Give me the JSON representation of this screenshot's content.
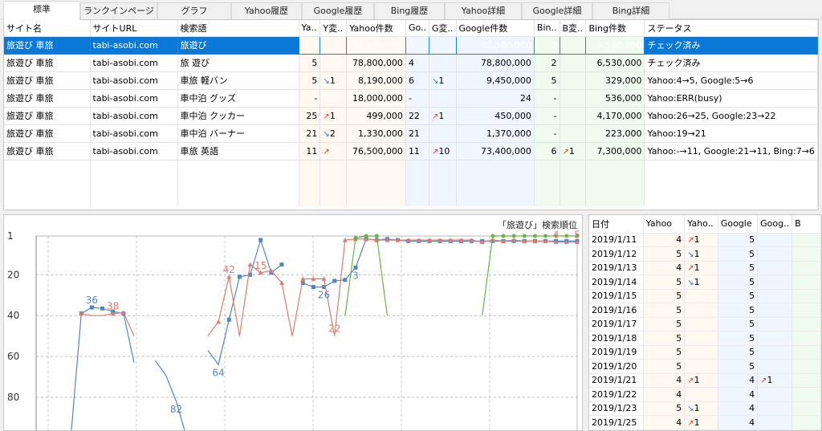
{
  "tabs": [
    "標準",
    "ランクインページ",
    "グラフ",
    "Yahoo履歴",
    "Google履歴",
    "Bing履歴",
    "Yahoo詳細",
    "Google詳細",
    "Bing詳細"
  ],
  "columns": [
    "サイト名",
    "サイトURL",
    "検索語",
    "Ya..",
    "Y変..",
    "Yahoo件数",
    "Go..",
    "G変..",
    "Google件数",
    "Bin..",
    "B変..",
    "Bing件数",
    "ステータス"
  ],
  "rows": [
    {
      "site": "旅遊び 車旅",
      "url": "tabi-asobi.com",
      "kw": "旅遊び",
      "y": "5",
      "yc": "",
      "yd": "",
      "yn": "82,300,000",
      "g": "5",
      "gc": "",
      "gd": "",
      "gn": "82,300,000",
      "b": "2",
      "bc": "",
      "bd": "",
      "bn": "6,530,000",
      "status": "チェック済み"
    },
    {
      "site": "旅遊び 車旅",
      "url": "tabi-asobi.com",
      "kw": "旅 遊び",
      "y": "5",
      "yc": "",
      "yd": "",
      "yn": "78,800,000",
      "g": "4",
      "gc": "",
      "gd": "",
      "gn": "78,800,000",
      "b": "2",
      "bc": "",
      "bd": "",
      "bn": "6,530,000",
      "status": "チェック済み"
    },
    {
      "site": "旅遊び 車旅",
      "url": "tabi-asobi.com",
      "kw": "車旅 軽バン",
      "y": "5",
      "yc": "1",
      "yd": "down",
      "yn": "8,190,000",
      "g": "6",
      "gc": "1",
      "gd": "down",
      "gn": "9,450,000",
      "b": "5",
      "bc": "",
      "bd": "",
      "bn": "329,000",
      "status": "Yahoo:4→5, Google:5→6"
    },
    {
      "site": "旅遊び 車旅",
      "url": "tabi-asobi.com",
      "kw": "車中泊 グッズ",
      "y": "-",
      "yc": "",
      "yd": "",
      "yn": "18,000,000",
      "g": "-",
      "gc": "",
      "gd": "",
      "gn": "24",
      "b": "-",
      "bc": "",
      "bd": "",
      "bn": "536,000",
      "status": "Yahoo:ERR(busy)"
    },
    {
      "site": "旅遊び 車旅",
      "url": "tabi-asobi.com",
      "kw": "車中泊 クッカー",
      "y": "25",
      "yc": "1",
      "yd": "up",
      "yn": "499,000",
      "g": "22",
      "gc": "1",
      "gd": "up",
      "gn": "450,000",
      "b": "-",
      "bc": "",
      "bd": "",
      "bn": "4,170,000",
      "status": "Yahoo:26→25, Google:23→22"
    },
    {
      "site": "旅遊び 車旅",
      "url": "tabi-asobi.com",
      "kw": "車中泊 バーナー",
      "y": "21",
      "yc": "2",
      "yd": "down",
      "yn": "1,330,000",
      "g": "21",
      "gc": "",
      "gd": "",
      "gn": "1,370,000",
      "b": "-",
      "bc": "",
      "bd": "",
      "bn": "223,000",
      "status": "Yahoo:19→21"
    },
    {
      "site": "旅遊び 車旅",
      "url": "tabi-asobi.com",
      "kw": "車旅 英語",
      "y": "11",
      "yc": "",
      "yd": "up",
      "yn": "76,500,000",
      "g": "11",
      "gc": "10",
      "gd": "up",
      "gn": "73,400,000",
      "b": "6",
      "bc": "1",
      "bd": "up",
      "bn": "7,300,000",
      "status": "Yahoo:-→11, Google:21→11, Bing:7→6"
    }
  ],
  "arrows": {
    "up": "↗",
    "down": "↘"
  },
  "history": {
    "columns": [
      "日付",
      "Yahoo",
      "Yaho..",
      "Google",
      "Goog..",
      "B"
    ],
    "rows": [
      {
        "date": "2019/1/11",
        "y": "4",
        "yc": "1",
        "yd": "up",
        "g": "5",
        "gc": "",
        "gd": ""
      },
      {
        "date": "2019/1/12",
        "y": "5",
        "yc": "1",
        "yd": "down",
        "g": "5",
        "gc": "",
        "gd": ""
      },
      {
        "date": "2019/1/13",
        "y": "4",
        "yc": "1",
        "yd": "up",
        "g": "5",
        "gc": "",
        "gd": ""
      },
      {
        "date": "2019/1/14",
        "y": "5",
        "yc": "1",
        "yd": "down",
        "g": "5",
        "gc": "",
        "gd": ""
      },
      {
        "date": "2019/1/15",
        "y": "5",
        "yc": "",
        "yd": "",
        "g": "5",
        "gc": "",
        "gd": ""
      },
      {
        "date": "2019/1/16",
        "y": "5",
        "yc": "",
        "yd": "",
        "g": "5",
        "gc": "",
        "gd": ""
      },
      {
        "date": "2019/1/17",
        "y": "5",
        "yc": "",
        "yd": "",
        "g": "5",
        "gc": "",
        "gd": ""
      },
      {
        "date": "2019/1/18",
        "y": "5",
        "yc": "",
        "yd": "",
        "g": "5",
        "gc": "",
        "gd": ""
      },
      {
        "date": "2019/1/19",
        "y": "5",
        "yc": "",
        "yd": "",
        "g": "5",
        "gc": "",
        "gd": ""
      },
      {
        "date": "2019/1/20",
        "y": "5",
        "yc": "",
        "yd": "",
        "g": "5",
        "gc": "",
        "gd": ""
      },
      {
        "date": "2019/1/21",
        "y": "4",
        "yc": "1",
        "yd": "up",
        "g": "4",
        "gc": "1",
        "gd": "up"
      },
      {
        "date": "2019/1/22",
        "y": "4",
        "yc": "",
        "yd": "",
        "g": "4",
        "gc": "",
        "gd": ""
      },
      {
        "date": "2019/1/23",
        "y": "5",
        "yc": "1",
        "yd": "down",
        "g": "4",
        "gc": "",
        "gd": ""
      },
      {
        "date": "2019/1/25",
        "y": "4",
        "yc": "1",
        "yd": "up",
        "g": "4",
        "gc": "",
        "gd": ""
      }
    ]
  },
  "colors": {
    "yahoo": "#4f86c6",
    "google": "#e07b6d",
    "bing": "#6fb14a",
    "selection": "#0a78d7",
    "yahoo_col": "#fff8f0",
    "google_col": "#f0f6ff",
    "bing_col": "#f0fbf0"
  },
  "chart_data": {
    "type": "line",
    "title": "「旅遊び」検索順位",
    "ylim": [
      1,
      100
    ],
    "y_inverted": true,
    "yticks": [
      1,
      20,
      40,
      60,
      80
    ],
    "grid": true,
    "series": [
      {
        "values": [
          null,
          100,
          39,
          36,
          36.5,
          38,
          39,
          63,
          null,
          62,
          69,
          82,
          100,
          null,
          57,
          64,
          42,
          21,
          20,
          3,
          19,
          15,
          null,
          24,
          26,
          26,
          23,
          22.5,
          16.5,
          2.5,
          3,
          2.5,
          3,
          3.5,
          3.5,
          3.5,
          3.5,
          3.5,
          3.5,
          3.5,
          3.5,
          3.5,
          3.5,
          3.5,
          3.5,
          3.5,
          3.5,
          3.5,
          3.5,
          3.5
        ]
      },
      {
        "values": [
          null,
          null,
          39,
          40,
          40,
          39,
          38.5,
          50,
          null,
          null,
          null,
          null,
          null,
          null,
          50,
          43,
          21,
          50,
          15,
          19,
          18,
          24,
          50,
          22,
          22,
          22,
          50,
          3,
          2.5,
          2.5,
          3,
          3,
          3,
          3,
          3,
          3,
          3,
          3,
          3,
          3,
          4,
          3,
          3.5,
          3,
          3.5,
          3.5,
          3.5,
          4,
          4,
          4
        ]
      },
      {
        "values": [
          null,
          null,
          null,
          null,
          null,
          null,
          null,
          null,
          null,
          null,
          null,
          null,
          null,
          null,
          null,
          null,
          null,
          null,
          null,
          null,
          null,
          null,
          null,
          null,
          null,
          null,
          null,
          40,
          2,
          1,
          1,
          40,
          null,
          null,
          null,
          null,
          null,
          null,
          null,
          null,
          40,
          1,
          1,
          1,
          1,
          1,
          1,
          1,
          1,
          1
        ]
      }
    ],
    "labels": [
      {
        "series": 0,
        "index": 3,
        "text": "36"
      },
      {
        "series": 1,
        "index": 5,
        "text": "38"
      },
      {
        "series": 1,
        "index": 16,
        "text": "42"
      },
      {
        "series": 1,
        "index": 19,
        "text": "15"
      },
      {
        "series": 0,
        "index": 15,
        "text": "64"
      },
      {
        "series": 0,
        "index": 11,
        "text": "82"
      },
      {
        "series": 0,
        "index": 25,
        "text": "26"
      },
      {
        "series": 1,
        "index": 26,
        "text": "22"
      },
      {
        "series": 0,
        "index": 28,
        "text": "3"
      },
      {
        "series": 1,
        "index": 47,
        "text": "4"
      },
      {
        "series": 1,
        "index": 49,
        "text": "5"
      }
    ]
  }
}
